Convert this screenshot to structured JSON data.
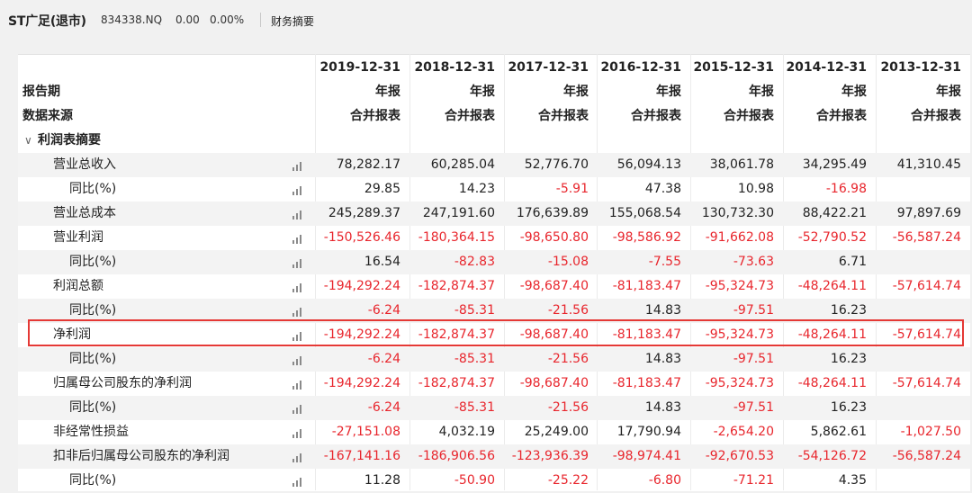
{
  "header": {
    "title": "ST广足(退市)",
    "code": "834338.NQ",
    "price": "0.00",
    "change_pct": "0.00%",
    "section": "财务摘要"
  },
  "columns": {
    "dates": [
      "2019-12-31",
      "2018-12-31",
      "2017-12-31",
      "2016-12-31",
      "2015-12-31",
      "2014-12-31",
      "2013-12-31"
    ],
    "report_period_label": "报告期",
    "report_period_value": "年报",
    "data_source_label": "数据来源",
    "data_source_value": "合并报表"
  },
  "group_title": "利润表摘要",
  "rows": [
    {
      "label": "营业总收入",
      "values": [
        "78,282.17",
        "60,285.04",
        "52,776.70",
        "56,094.13",
        "38,061.78",
        "34,295.49",
        "41,310.45"
      ]
    },
    {
      "label": "同比(%)",
      "values": [
        "29.85",
        "14.23",
        "-5.91",
        "47.38",
        "10.98",
        "-16.98",
        ""
      ]
    },
    {
      "label": "营业总成本",
      "values": [
        "245,289.37",
        "247,191.60",
        "176,639.89",
        "155,068.54",
        "130,732.30",
        "88,422.21",
        "97,897.69"
      ]
    },
    {
      "label": "营业利润",
      "values": [
        "-150,526.46",
        "-180,364.15",
        "-98,650.80",
        "-98,586.92",
        "-91,662.08",
        "-52,790.52",
        "-56,587.24"
      ]
    },
    {
      "label": "同比(%)",
      "values": [
        "16.54",
        "-82.83",
        "-15.08",
        "-7.55",
        "-73.63",
        "6.71",
        ""
      ]
    },
    {
      "label": "利润总额",
      "values": [
        "-194,292.24",
        "-182,874.37",
        "-98,687.40",
        "-81,183.47",
        "-95,324.73",
        "-48,264.11",
        "-57,614.74"
      ]
    },
    {
      "label": "同比(%)",
      "values": [
        "-6.24",
        "-85.31",
        "-21.56",
        "14.83",
        "-97.51",
        "16.23",
        ""
      ]
    },
    {
      "label": "净利润",
      "values": [
        "-194,292.24",
        "-182,874.37",
        "-98,687.40",
        "-81,183.47",
        "-95,324.73",
        "-48,264.11",
        "-57,614.74"
      ]
    },
    {
      "label": "同比(%)",
      "values": [
        "-6.24",
        "-85.31",
        "-21.56",
        "14.83",
        "-97.51",
        "16.23",
        ""
      ]
    },
    {
      "label": "归属母公司股东的净利润",
      "values": [
        "-194,292.24",
        "-182,874.37",
        "-98,687.40",
        "-81,183.47",
        "-95,324.73",
        "-48,264.11",
        "-57,614.74"
      ]
    },
    {
      "label": "同比(%)",
      "values": [
        "-6.24",
        "-85.31",
        "-21.56",
        "14.83",
        "-97.51",
        "16.23",
        ""
      ]
    },
    {
      "label": "非经常性损益",
      "values": [
        "-27,151.08",
        "4,032.19",
        "25,249.00",
        "17,790.94",
        "-2,654.20",
        "5,862.61",
        "-1,027.50"
      ]
    },
    {
      "label": "扣非后归属母公司股东的净利润",
      "values": [
        "-167,141.16",
        "-186,906.56",
        "-123,936.39",
        "-98,974.41",
        "-92,670.53",
        "-54,126.72",
        "-56,587.24"
      ]
    },
    {
      "label": "同比(%)",
      "values": [
        "11.28",
        "-50.90",
        "-25.22",
        "-6.80",
        "-71.21",
        "4.35",
        ""
      ]
    }
  ],
  "colors": {
    "negative": "#e8262d",
    "highlight": "#e53935",
    "bar_icon": "#8a8a8a"
  },
  "icon": "bar-chart-icon",
  "highlighted_row_label": "净利润"
}
